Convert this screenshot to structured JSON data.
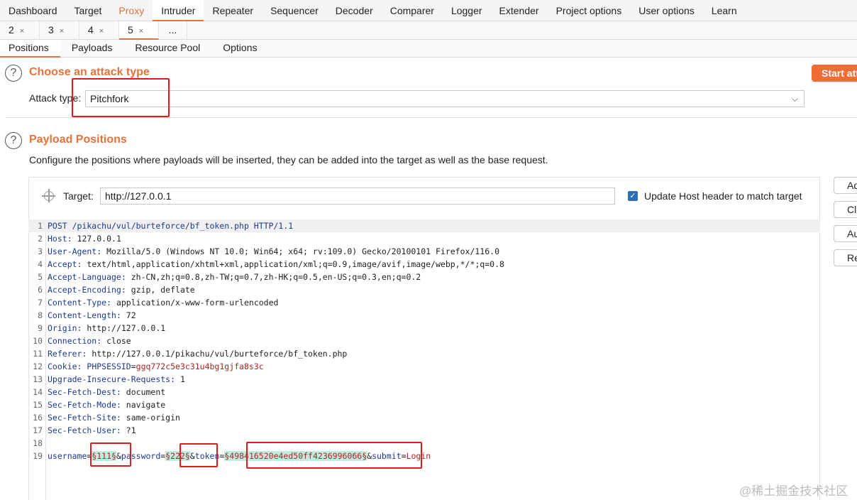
{
  "top_tabs": [
    "Dashboard",
    "Target",
    "Proxy",
    "Intruder",
    "Repeater",
    "Sequencer",
    "Decoder",
    "Comparer",
    "Logger",
    "Extender",
    "Project options",
    "User options",
    "Learn"
  ],
  "intruder_tabs": [
    "2",
    "3",
    "4",
    "5",
    "..."
  ],
  "close_glyph": "×",
  "sub_tabs": [
    "Positions",
    "Payloads",
    "Resource Pool",
    "Options"
  ],
  "attack": {
    "section_title": "Choose an attack type",
    "start_label": "Start attack",
    "type_label": "Attack type:",
    "type_value": "Pitchfork"
  },
  "positions": {
    "section_title": "Payload Positions",
    "description": "Configure the positions where payloads will be inserted, they can be added into the target as well as the base request.",
    "target_label": "Target:",
    "target_value": "http://127.0.0.1",
    "update_host_label": "Update Host header to match target",
    "update_host_checked": true
  },
  "side_buttons": [
    "Add §",
    "Clear §",
    "Auto §",
    "Refresh"
  ],
  "request_lines": [
    {
      "n": "1",
      "key": "POST /pikachu/vul/burteforce/bf_token.php HTTP/1.1",
      "value": ""
    },
    {
      "n": "2",
      "key": "Host",
      "value": "127.0.0.1"
    },
    {
      "n": "3",
      "key": "User-Agent",
      "value": "Mozilla/5.0 (Windows NT 10.0; Win64; x64; rv:109.0) Gecko/20100101 Firefox/116.0"
    },
    {
      "n": "4",
      "key": "Accept",
      "value": "text/html,application/xhtml+xml,application/xml;q=0.9,image/avif,image/webp,*/*;q=0.8"
    },
    {
      "n": "5",
      "key": "Accept-Language",
      "value": "zh-CN,zh;q=0.8,zh-TW;q=0.7,zh-HK;q=0.5,en-US;q=0.3,en;q=0.2"
    },
    {
      "n": "6",
      "key": "Accept-Encoding",
      "value": "gzip, deflate"
    },
    {
      "n": "7",
      "key": "Content-Type",
      "value": "application/x-www-form-urlencoded"
    },
    {
      "n": "8",
      "key": "Content-Length",
      "value": "72"
    },
    {
      "n": "9",
      "key": "Origin",
      "value": "http://127.0.0.1"
    },
    {
      "n": "10",
      "key": "Connection",
      "value": "close"
    },
    {
      "n": "11",
      "key": "Referer",
      "value": "http://127.0.0.1/pikachu/vul/burteforce/bf_token.php"
    },
    {
      "n": "12",
      "key": "Cookie",
      "cookie_name": "PHPSESSID",
      "cookie_value": "ggq772c5e3c31u4bg1gjfa8s3c"
    },
    {
      "n": "13",
      "key": "Upgrade-Insecure-Requests",
      "value": "1"
    },
    {
      "n": "14",
      "key": "Sec-Fetch-Dest",
      "value": "document"
    },
    {
      "n": "15",
      "key": "Sec-Fetch-Mode",
      "value": "navigate"
    },
    {
      "n": "16",
      "key": "Sec-Fetch-Site",
      "value": "same-origin"
    },
    {
      "n": "17",
      "key": "Sec-Fetch-User",
      "value": "?1"
    },
    {
      "n": "18",
      "key": "",
      "value": ""
    },
    {
      "n": "19",
      "body": true
    }
  ],
  "body": {
    "p1_name": "username",
    "p1_payload": "§111§",
    "p2_name": "password",
    "p2_payload": "§222§",
    "p3_name": "token",
    "p3_payload": "§498416520e4ed50ff4236996066§",
    "p4_name": "submit",
    "p4_value": "Login"
  },
  "watermark": "@稀土掘金技术社区"
}
